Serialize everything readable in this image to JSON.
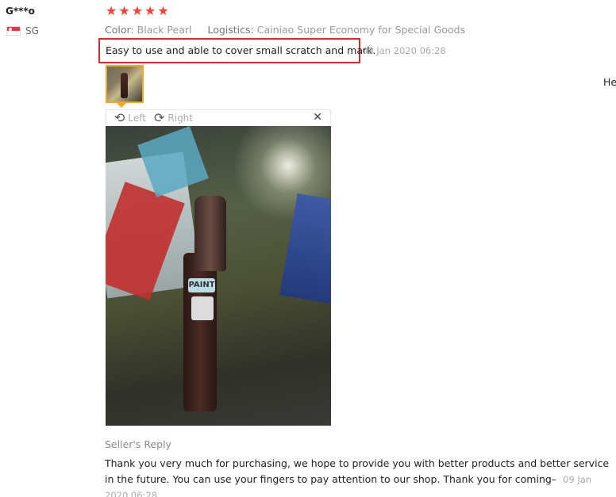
{
  "reviewer": {
    "name": "G***o",
    "country_code": "SG"
  },
  "rating": {
    "stars": 5,
    "star_color": "#f44336"
  },
  "meta": {
    "color_label": "Color:",
    "color_value": "Black Pearl",
    "logistics_label": "Logistics:",
    "logistics_value": "Cainiao Super Economy for Special Goods"
  },
  "review": {
    "text": "Easy to use and able to cover small scratch and mark.",
    "date": "09 Jan 2020 06:28",
    "highlight_color": "#e3262e"
  },
  "side_text": "He",
  "viewer": {
    "left_label": "Left",
    "right_label": "Right",
    "close_glyph": "✕",
    "rotate_left_icon": "rotate-left-icon",
    "rotate_right_icon": "rotate-right-icon",
    "photo_label_text": "PAINT"
  },
  "seller_reply": {
    "title": "Seller's Reply",
    "text": "Thank you very much for purchasing, we hope to provide you with better products and better service in the future. You can use your fingers to pay attention to our shop. Thank you for coming–",
    "date": "09 Jan 2020 06:28"
  }
}
